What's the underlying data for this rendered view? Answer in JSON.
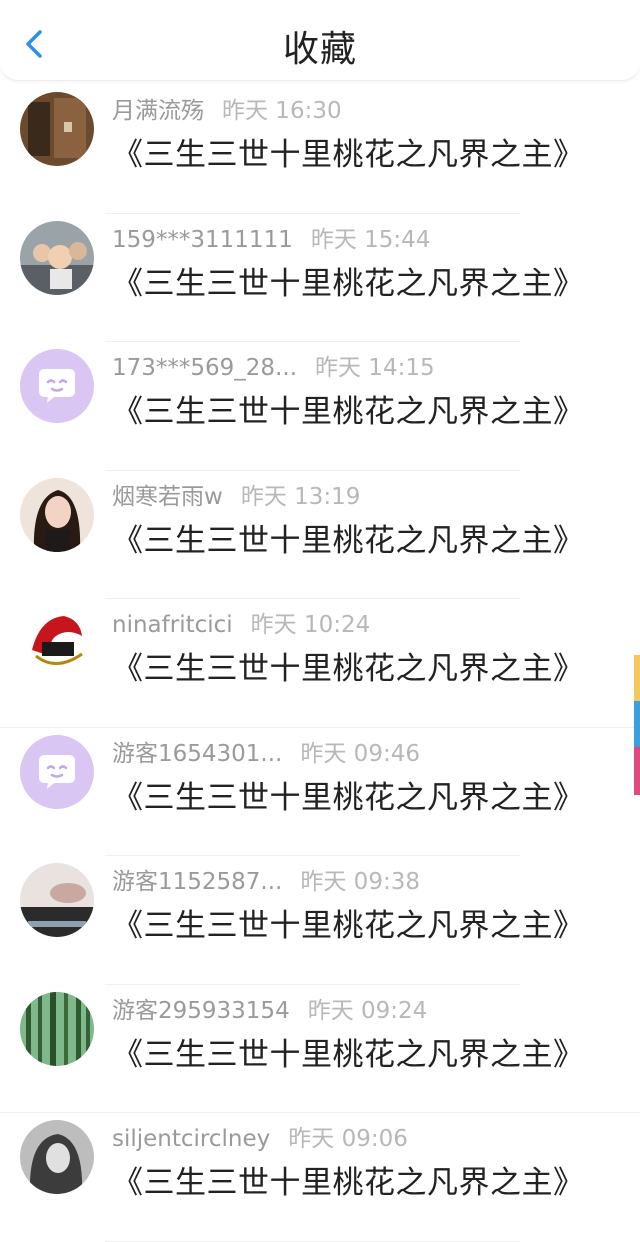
{
  "header": {
    "title": "收藏"
  },
  "items": [
    {
      "user": "月满流殇",
      "time": "昨天 16:30",
      "book": "《三生三世十里桃花之凡界之主》",
      "avatar": "photo-avatar"
    },
    {
      "user": "159***3111111",
      "time": "昨天 15:44",
      "book": "《三生三世十里桃花之凡界之主》",
      "avatar": "group-photo-avatar"
    },
    {
      "user": "173***569_28...",
      "time": "昨天 14:15",
      "book": "《三生三世十里桃花之凡界之主》",
      "avatar": "default-avatar"
    },
    {
      "user": "烟寒若雨w",
      "time": "昨天 13:19",
      "book": "《三生三世十里桃花之凡界之主》",
      "avatar": "portrait-avatar"
    },
    {
      "user": "ninafritcici",
      "time": "昨天 10:24",
      "book": "《三生三世十里桃花之凡界之主》",
      "avatar": "logo-avatar"
    },
    {
      "user": "游客1654301...",
      "time": "昨天 09:46",
      "book": "《三生三世十里桃花之凡界之主》",
      "avatar": "default-avatar"
    },
    {
      "user": "游客1152587...",
      "time": "昨天 09:38",
      "book": "《三生三世十里桃花之凡界之主》",
      "avatar": "photo-avatar"
    },
    {
      "user": "游客295933154",
      "time": "昨天 09:24",
      "book": "《三生三世十里桃花之凡界之主》",
      "avatar": "forest-avatar"
    },
    {
      "user": "siljentcirclney",
      "time": "昨天 09:06",
      "book": "《三生三世十里桃花之凡界之主》",
      "avatar": "grayscale-avatar"
    }
  ],
  "colors": {
    "accent": "#2f8fe8",
    "default_avatar_bg": "#d9c6f3",
    "tab_yellow": "#f4c85a",
    "tab_blue": "#3aa0e0",
    "tab_pink": "#e04a7a"
  }
}
